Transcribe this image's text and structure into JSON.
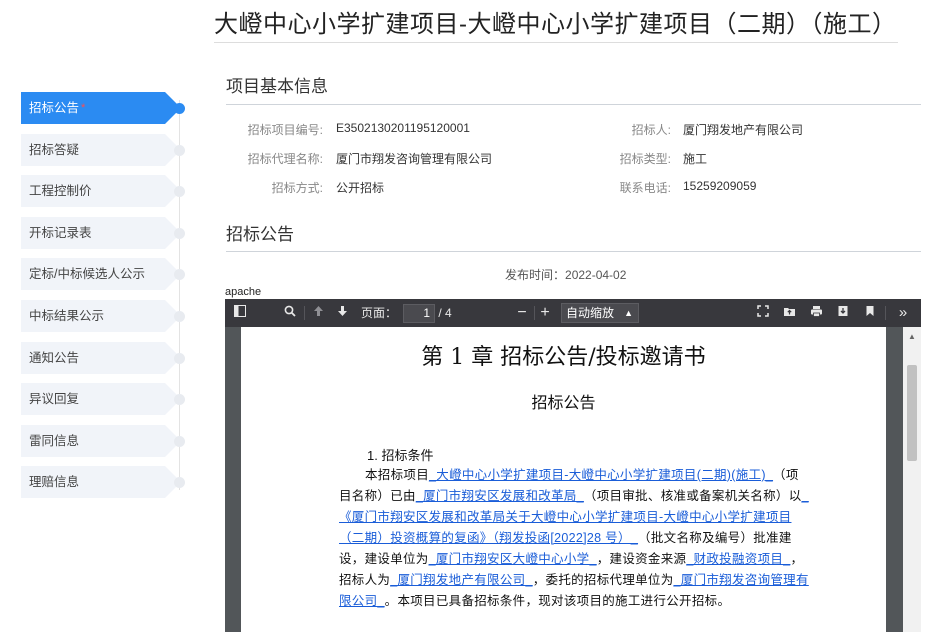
{
  "title": "大嶝中心小学扩建项目-大嶝中心小学扩建项目（二期）（施工）",
  "sidebar": {
    "items": [
      {
        "label": "招标公告",
        "active": true,
        "star": "*"
      },
      {
        "label": "招标答疑"
      },
      {
        "label": "工程控制价"
      },
      {
        "label": "开标记录表"
      },
      {
        "label": "定标/中标候选人公示"
      },
      {
        "label": "中标结果公示"
      },
      {
        "label": "通知公告"
      },
      {
        "label": "异议回复"
      },
      {
        "label": "雷同信息"
      },
      {
        "label": "理赔信息"
      }
    ]
  },
  "info_section": {
    "title": "项目基本信息",
    "fields": {
      "project_no_label": "招标项目编号:",
      "project_no": "E3502130201195120001",
      "tenderer_label": "招标人:",
      "tenderer": "厦门翔发地产有限公司",
      "agency_label": "招标代理名称:",
      "agency": "厦门市翔发咨询管理有限公司",
      "type_label": "招标类型:",
      "type": "施工",
      "method_label": "招标方式:",
      "method": "公开招标",
      "phone_label": "联系电话:",
      "phone": "15259209059"
    }
  },
  "notice_section": {
    "title": "招标公告",
    "publish_label": "发布时间：",
    "publish_date": "2022-04-02"
  },
  "pdf": {
    "server_text": "apache",
    "page_label": "页面：",
    "page_current": "1",
    "page_total": "/ 4",
    "zoom": "自动缩放",
    "doc_title": "第 1 章 招标公告/投标邀请书",
    "doc_subtitle": "招标公告",
    "section_heading": "1. 招标条件",
    "body": [
      {
        "t": "本招标项目"
      },
      {
        "t": "_大嶝中心小学扩建项目-大嶝中心小学扩建项目(二期)(施工)_",
        "link": true
      },
      {
        "t": "（项目名称）已由"
      },
      {
        "t": "_厦门市翔安区发展和改革局_",
        "link": true
      },
      {
        "t": "（项目审批、核准或备案机关名称）以"
      },
      {
        "t": "_《厦门市翔安区发展和改革局关于大嶝中心小学扩建项目-大嶝中心小学扩建项目（二期）投资概算的复函》（翔发投函[2022]28 号）_",
        "link": true
      },
      {
        "t": "（批文名称及编号）批准建设，建设单位为"
      },
      {
        "t": "_厦门市翔安区大嶝中心小学_",
        "link": true
      },
      {
        "t": "，建设资金来源"
      },
      {
        "t": "_财政投融资项目_",
        "link": true
      },
      {
        "t": "，招标人为"
      },
      {
        "t": "_厦门翔发地产有限公司_",
        "link": true
      },
      {
        "t": "，委托的招标代理单位为"
      },
      {
        "t": "_厦门市翔发咨询管理有限公司_",
        "link": true
      },
      {
        "t": "。本项目已具备招标条件，现对该项目的施工进行公开招标。"
      }
    ]
  },
  "colors": {
    "accent": "#2b8bf2",
    "nav_bg": "#f1f4f9",
    "toolbar": "#38383d",
    "viewer_bg": "#525659",
    "link": "#1a5dd8"
  }
}
